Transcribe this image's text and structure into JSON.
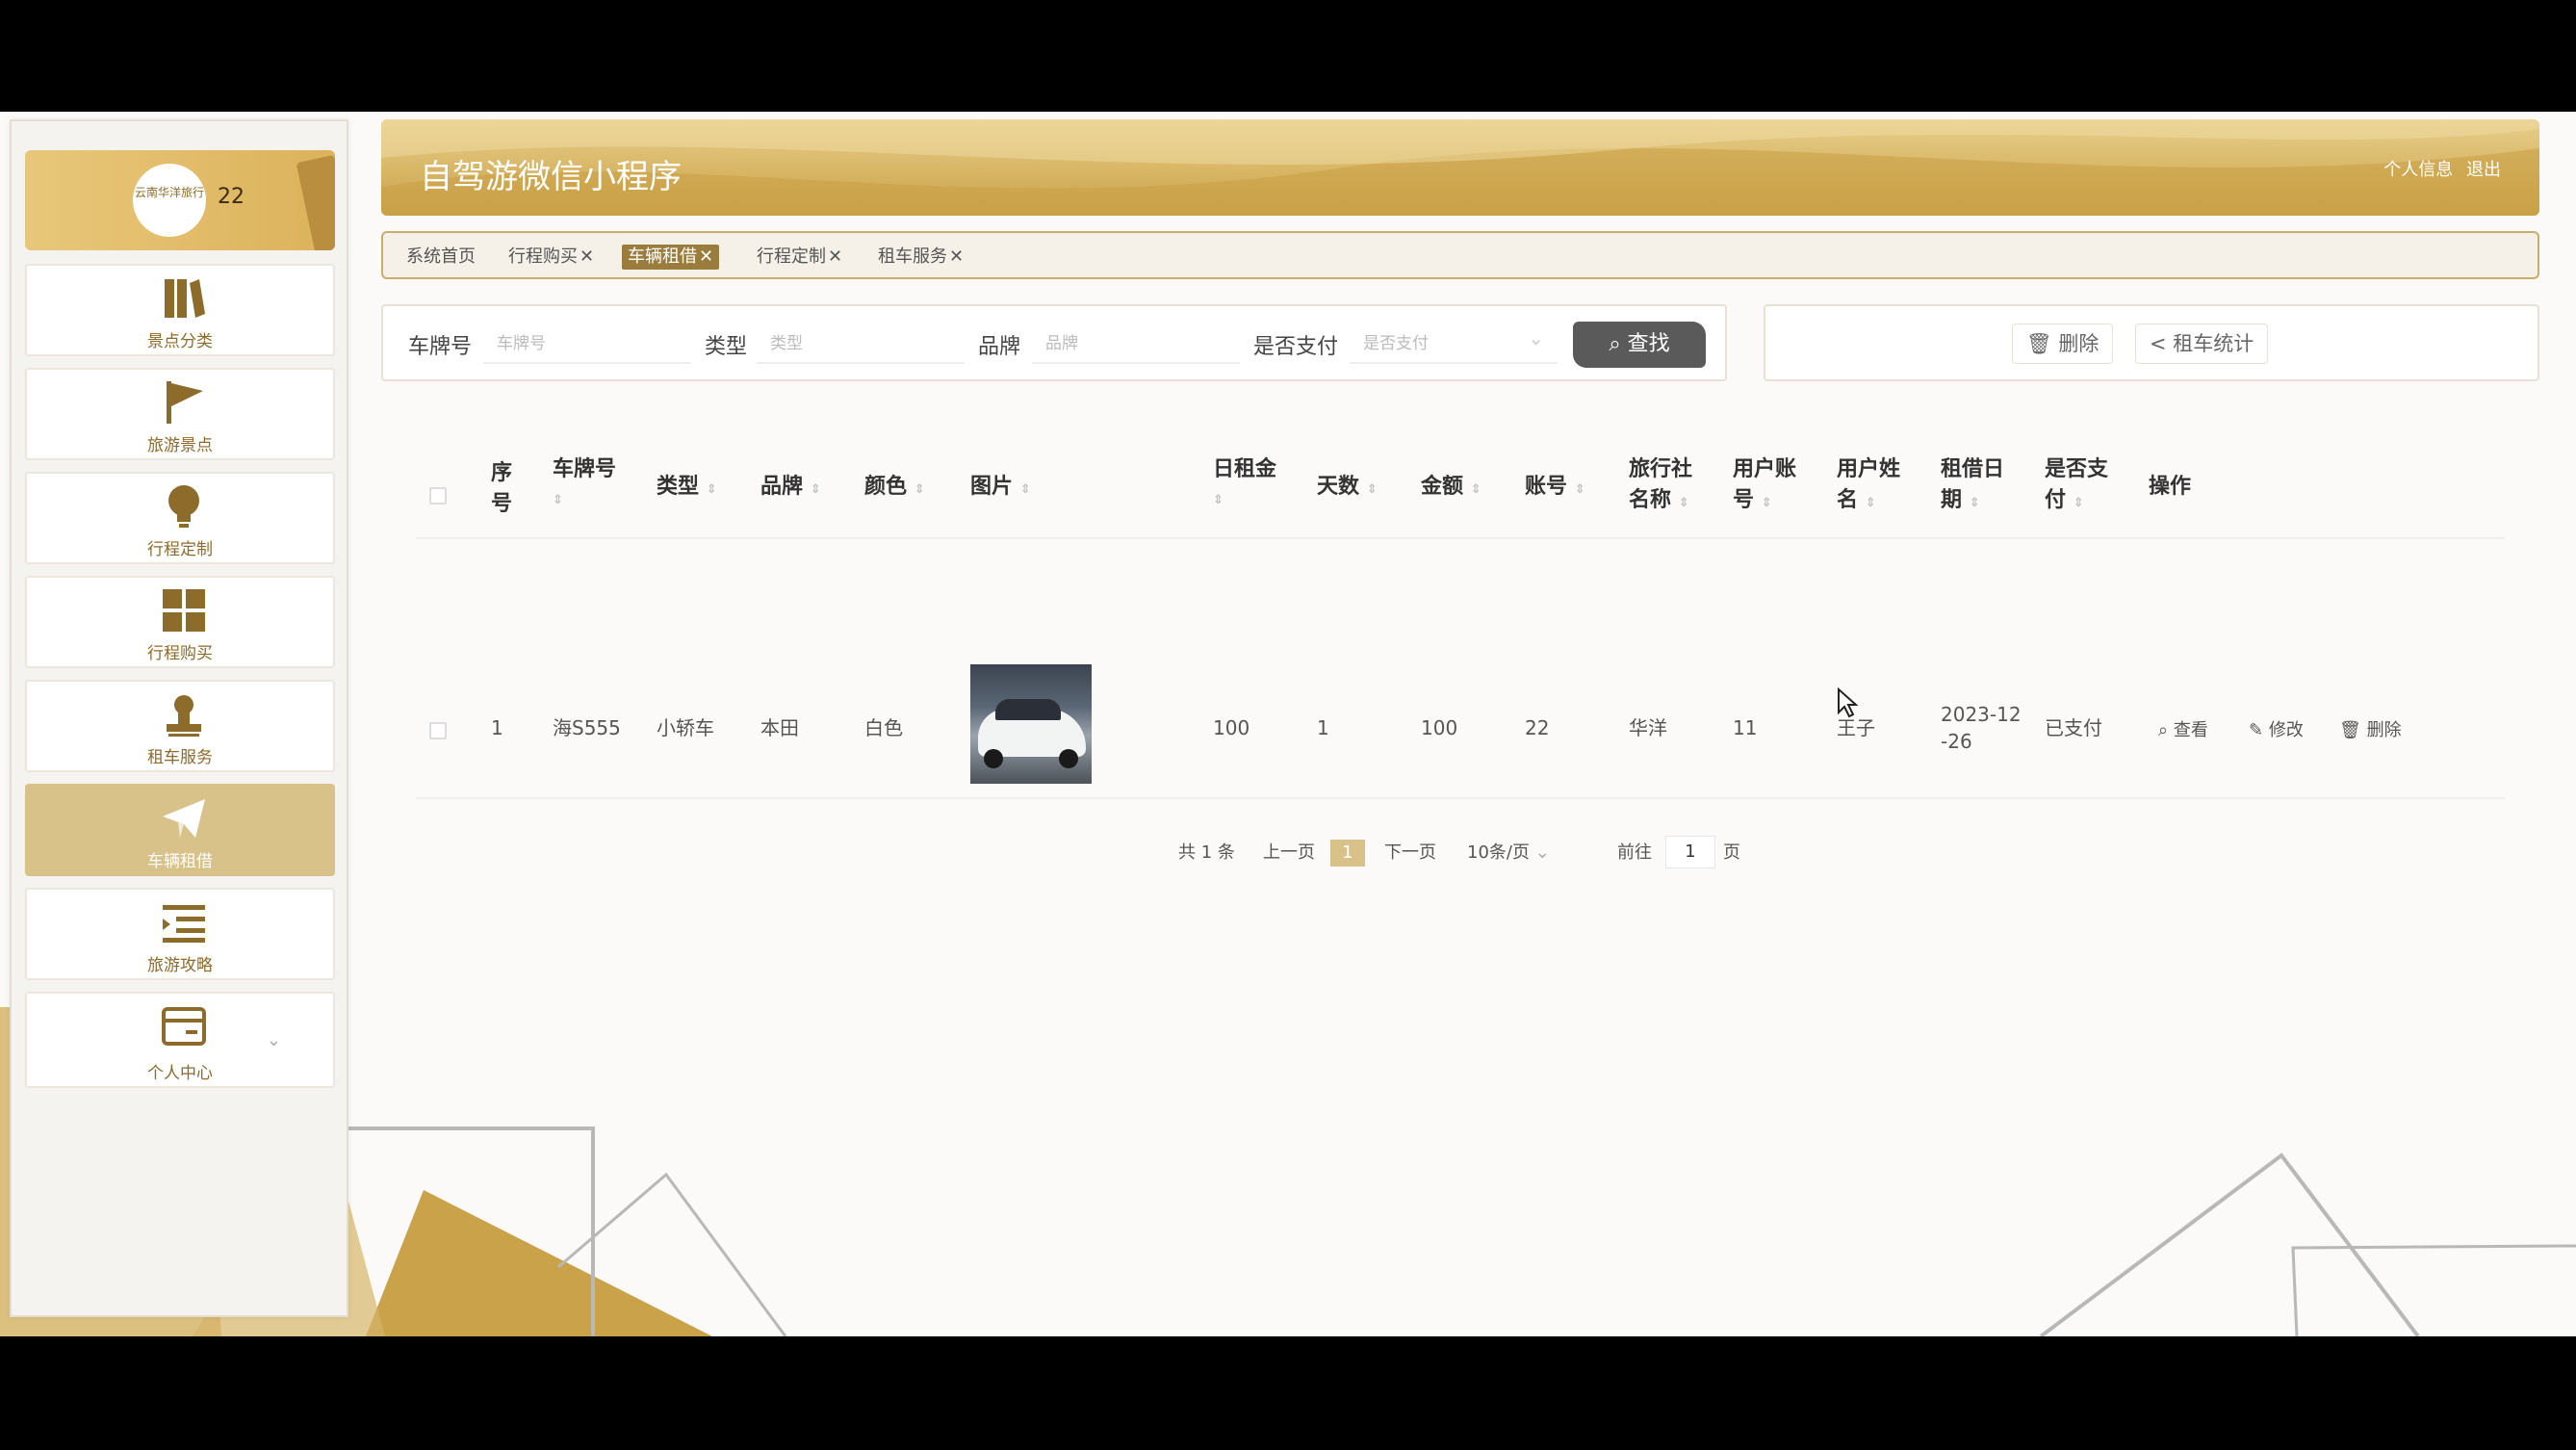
{
  "sidebar": {
    "avatar_text": "云南华洋旅行",
    "profile_count": "22",
    "items": [
      {
        "label": "景点分类",
        "icon": "books-icon"
      },
      {
        "label": "旅游景点",
        "icon": "flag-icon"
      },
      {
        "label": "行程定制",
        "icon": "lightbulb-icon"
      },
      {
        "label": "行程购买",
        "icon": "grid-icon"
      },
      {
        "label": "租车服务",
        "icon": "user-stamp-icon"
      },
      {
        "label": "车辆租借",
        "icon": "paper-plane-icon"
      },
      {
        "label": "旅游攻略",
        "icon": "list-indent-icon"
      },
      {
        "label": "个人中心",
        "icon": "card-icon"
      }
    ]
  },
  "header": {
    "title": "自驾游微信小程序",
    "profile_link": "个人信息",
    "logout_link": "退出"
  },
  "tabs": [
    {
      "label": "系统首页",
      "closable": false
    },
    {
      "label": "行程购买",
      "closable": true
    },
    {
      "label": "车辆租借",
      "closable": true,
      "active": true
    },
    {
      "label": "行程定制",
      "closable": true
    },
    {
      "label": "租车服务",
      "closable": true
    }
  ],
  "search": {
    "plate_label": "车牌号",
    "plate_placeholder": "车牌号",
    "type_label": "类型",
    "type_placeholder": "类型",
    "brand_label": "品牌",
    "brand_placeholder": "品牌",
    "paid_label": "是否支付",
    "paid_placeholder": "是否支付",
    "button": "查找"
  },
  "actions": {
    "delete": "删除",
    "stats": "租车统计"
  },
  "table": {
    "headers": {
      "index": [
        "序",
        "号"
      ],
      "plate": "车牌号",
      "type": "类型",
      "brand": "品牌",
      "color": "颜色",
      "image": "图片",
      "daily": "日租金",
      "days": "天数",
      "amount": "金额",
      "account": "账号",
      "agency": [
        "旅行社",
        "名称"
      ],
      "user_acct": [
        "用户账",
        "号"
      ],
      "user_name": [
        "用户姓",
        "名"
      ],
      "rent_date": [
        "租借日",
        "期"
      ],
      "paid": [
        "是否支",
        "付"
      ],
      "ops": "操作"
    },
    "rows": [
      {
        "index": "1",
        "plate": "海S555",
        "type": "小轿车",
        "brand": "本田",
        "color": "白色",
        "daily": "100",
        "days": "1",
        "amount": "100",
        "account": "22",
        "agency": "华洋",
        "user_acct": "11",
        "user_name": "王子",
        "rent_date": [
          "2023-12",
          "-26"
        ],
        "paid": "已支付",
        "op_view": "查看",
        "op_edit": "修改",
        "op_delete": "删除"
      }
    ]
  },
  "pagination": {
    "total": "共 1 条",
    "prev": "上一页",
    "page": "1",
    "next": "下一页",
    "page_size": "10条/页",
    "goto_label": "前往",
    "goto_value": "1",
    "goto_suffix": "页"
  },
  "colors": {
    "accent": "#d9c18a",
    "header_gold": "#d7b564",
    "dark_button": "#5a5a5a"
  }
}
